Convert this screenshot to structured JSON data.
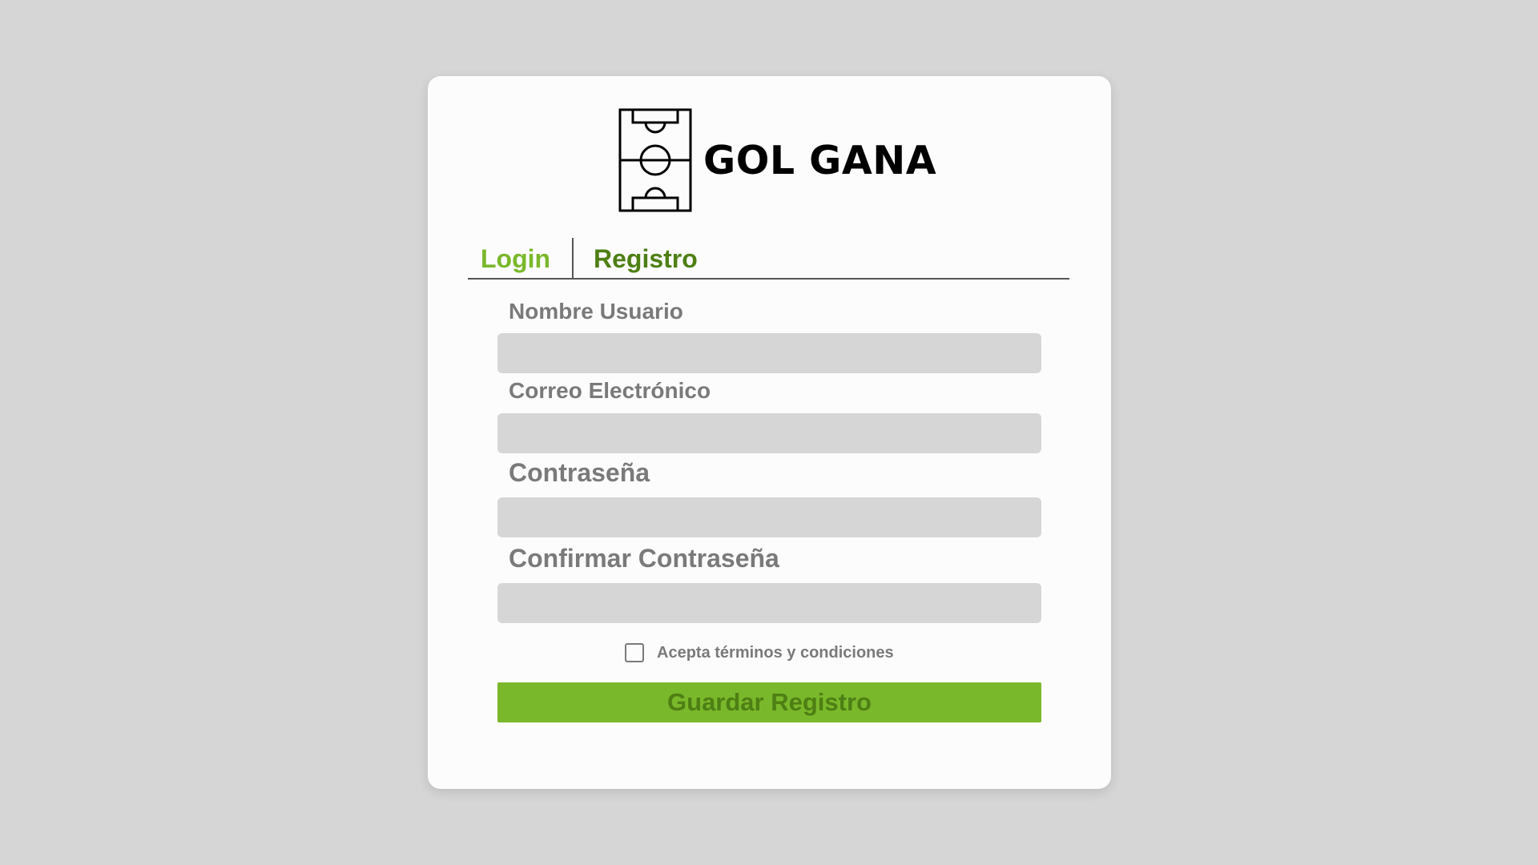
{
  "brand": {
    "name": "GOL GANA",
    "logo_icon": "soccer-field-icon"
  },
  "tabs": {
    "login_label": "Login",
    "registro_label": "Registro",
    "active": "Registro"
  },
  "form": {
    "fields": [
      {
        "label": "Nombre Usuario",
        "value": "",
        "placeholder": ""
      },
      {
        "label": "Correo Electrónico",
        "value": "",
        "placeholder": ""
      },
      {
        "label": "Contraseña",
        "value": "",
        "placeholder": ""
      },
      {
        "label": "Confirmar Contraseña",
        "value": "",
        "placeholder": ""
      }
    ],
    "terms_label": "Acepta términos y condiciones",
    "terms_checked": false,
    "submit_label": "Guardar Registro"
  },
  "colors": {
    "background": "#d6d6d6",
    "card": "#fcfcfc",
    "accent_light": "#7ab82b",
    "accent_dark": "#4e7f14",
    "label_gray": "#7a7a7a",
    "input_bg": "#d6d6d6"
  }
}
